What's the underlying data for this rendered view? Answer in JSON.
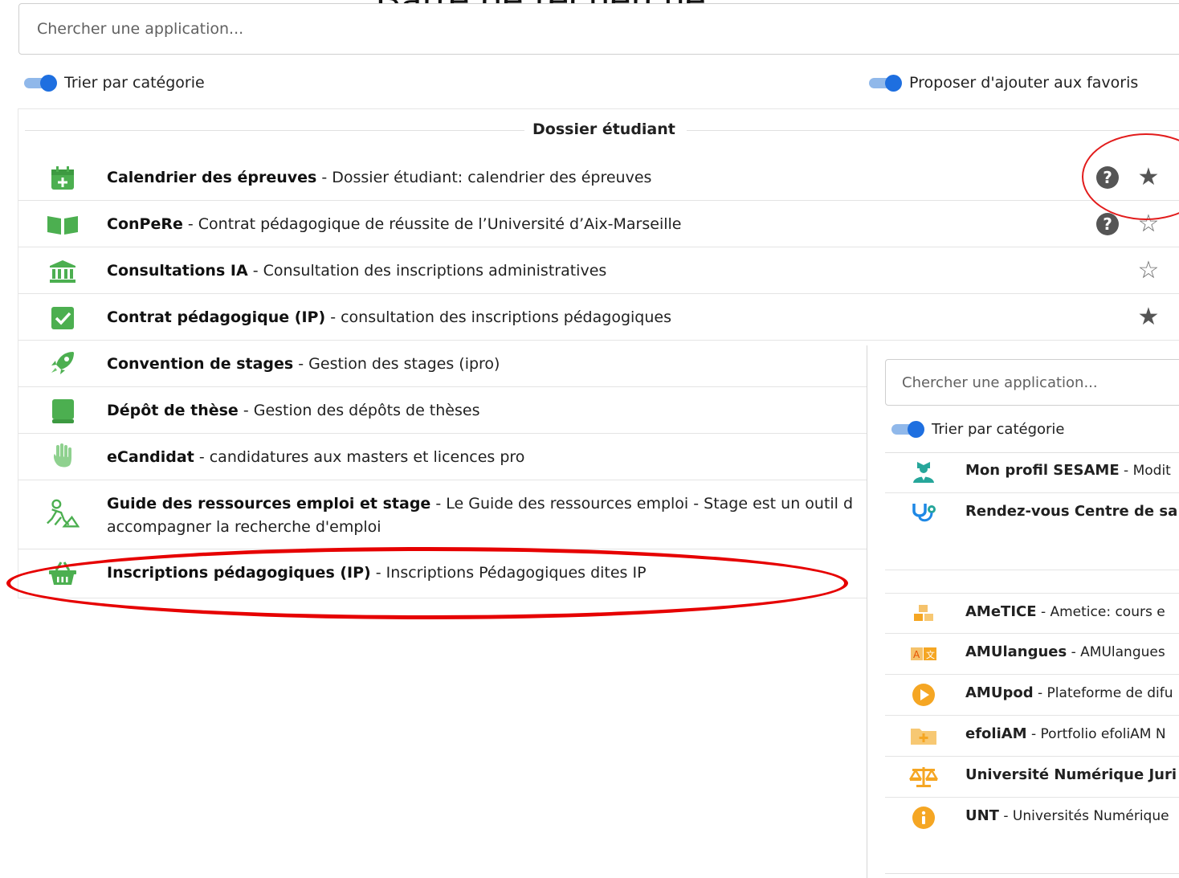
{
  "annotation": {
    "title": "Barre de recherche"
  },
  "search": {
    "placeholder": "Chercher une application..."
  },
  "toggles": {
    "sort_by_category": "Trier par catégorie",
    "suggest_favorites": "Proposer d'ajouter aux favoris"
  },
  "category": {
    "name": "Dossier étudiant"
  },
  "apps": [
    {
      "name": "Calendrier des épreuves",
      "desc": " - Dossier étudiant: calendrier des épreuves",
      "icon": "calendar-plus-icon",
      "help": true,
      "favorite": true
    },
    {
      "name": "ConPeRe",
      "desc": " - Contrat pédagogique de réussite de l’Université d’Aix-Marseille",
      "icon": "book-open-icon",
      "help": true,
      "favorite": false
    },
    {
      "name": "Consultations IA",
      "desc": " - Consultation des inscriptions administratives",
      "icon": "university-icon",
      "help": false,
      "favorite": false
    },
    {
      "name": "Contrat pédagogique (IP)",
      "desc": " - consultation des inscriptions pédagogiques",
      "icon": "checkbox-icon",
      "help": false,
      "favorite": true
    },
    {
      "name": "Convention de stages",
      "desc": " - Gestion des stages (ipro)",
      "icon": "rocket-icon"
    },
    {
      "name": "Dépôt de thèse",
      "desc": " - Gestion des dépôts de thèses",
      "icon": "book-icon"
    },
    {
      "name": "eCandidat",
      "desc": " - candidatures aux masters et licences pro",
      "icon": "hand-icon"
    },
    {
      "name": "Guide des ressources emploi et stage",
      "desc": " - Le Guide des ressources emploi - Stage est un outil d",
      "desc2": "accompagner la recherche d'emploi",
      "icon": "worker-icon"
    },
    {
      "name": "Inscriptions pédagogiques (IP)",
      "desc": " - Inscriptions Pédagogiques dites IP",
      "icon": "basket-icon"
    }
  ],
  "secondary": {
    "search_placeholder": "Chercher une application...",
    "sort_label": "Trier par catégorie",
    "apps": [
      {
        "name": "Mon profil SESAME",
        "desc": " - Modit",
        "icon": "user-profile-icon"
      },
      {
        "name": "Rendez-vous Centre de sa",
        "desc": "",
        "icon": "stethoscope-icon"
      },
      {
        "name": "AMeTICE",
        "desc": " - Ametice: cours e",
        "icon": "cubes-icon"
      },
      {
        "name": "AMUlangues",
        "desc": " - AMUlangues",
        "icon": "language-icon"
      },
      {
        "name": "AMUpod",
        "desc": " - Plateforme de difu",
        "icon": "play-icon"
      },
      {
        "name": "efoliAM",
        "desc": " - Portfolio efoliAM N",
        "icon": "folder-plus-icon"
      },
      {
        "name": "Université Numérique Juri",
        "desc": "",
        "icon": "balance-scale-icon"
      },
      {
        "name": "UNT",
        "desc": " - Universités Numérique",
        "icon": "info-icon"
      }
    ]
  },
  "colors": {
    "accent": "#1e6fe0",
    "icon_green": "#4caf50",
    "icon_orange": "#f5a623",
    "annotation_red": "#e60000"
  }
}
